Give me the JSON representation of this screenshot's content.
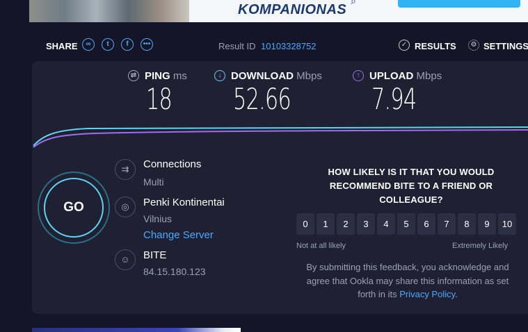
{
  "banner": {
    "brand_text": "KOMPANIONAS"
  },
  "topbar": {
    "share_label": "SHARE",
    "result_label": "Result ID",
    "result_id": "10103328752",
    "results_label": "RESULTS",
    "settings_label": "SETTINGS"
  },
  "metrics": {
    "ping": {
      "label": "PING",
      "unit": "ms",
      "value": "18"
    },
    "download": {
      "label": "DOWNLOAD",
      "unit": "Mbps",
      "value": "52.66"
    },
    "upload": {
      "label": "UPLOAD",
      "unit": "Mbps",
      "value": "7.94"
    }
  },
  "go_label": "GO",
  "connections": {
    "title": "Connections",
    "value": "Multi"
  },
  "server": {
    "name": "Penki Kontinentai",
    "location": "Vilnius",
    "change_label": "Change Server"
  },
  "provider": {
    "name": "BITE",
    "ip": "84.15.180.123"
  },
  "survey": {
    "question": "HOW LIKELY IS IT THAT YOU WOULD RECOMMEND BITE TO A FRIEND OR COLLEAGUE?",
    "scale": [
      "0",
      "1",
      "2",
      "3",
      "4",
      "5",
      "6",
      "7",
      "8",
      "9",
      "10"
    ],
    "low_label": "Not at all likely",
    "high_label": "Extremely Likely",
    "disclaimer": "By submitting this feedback, you acknowledge and agree that Ookla may share this information as set forth in its",
    "privacy_link": "Privacy Policy",
    "disclaimer_end": "."
  },
  "colors": {
    "accent": "#4aa8ff",
    "download_line": "#5fd3f0",
    "upload_line": "#a06cf0",
    "panel_bg": "#1f2133",
    "page_bg": "#141526"
  }
}
